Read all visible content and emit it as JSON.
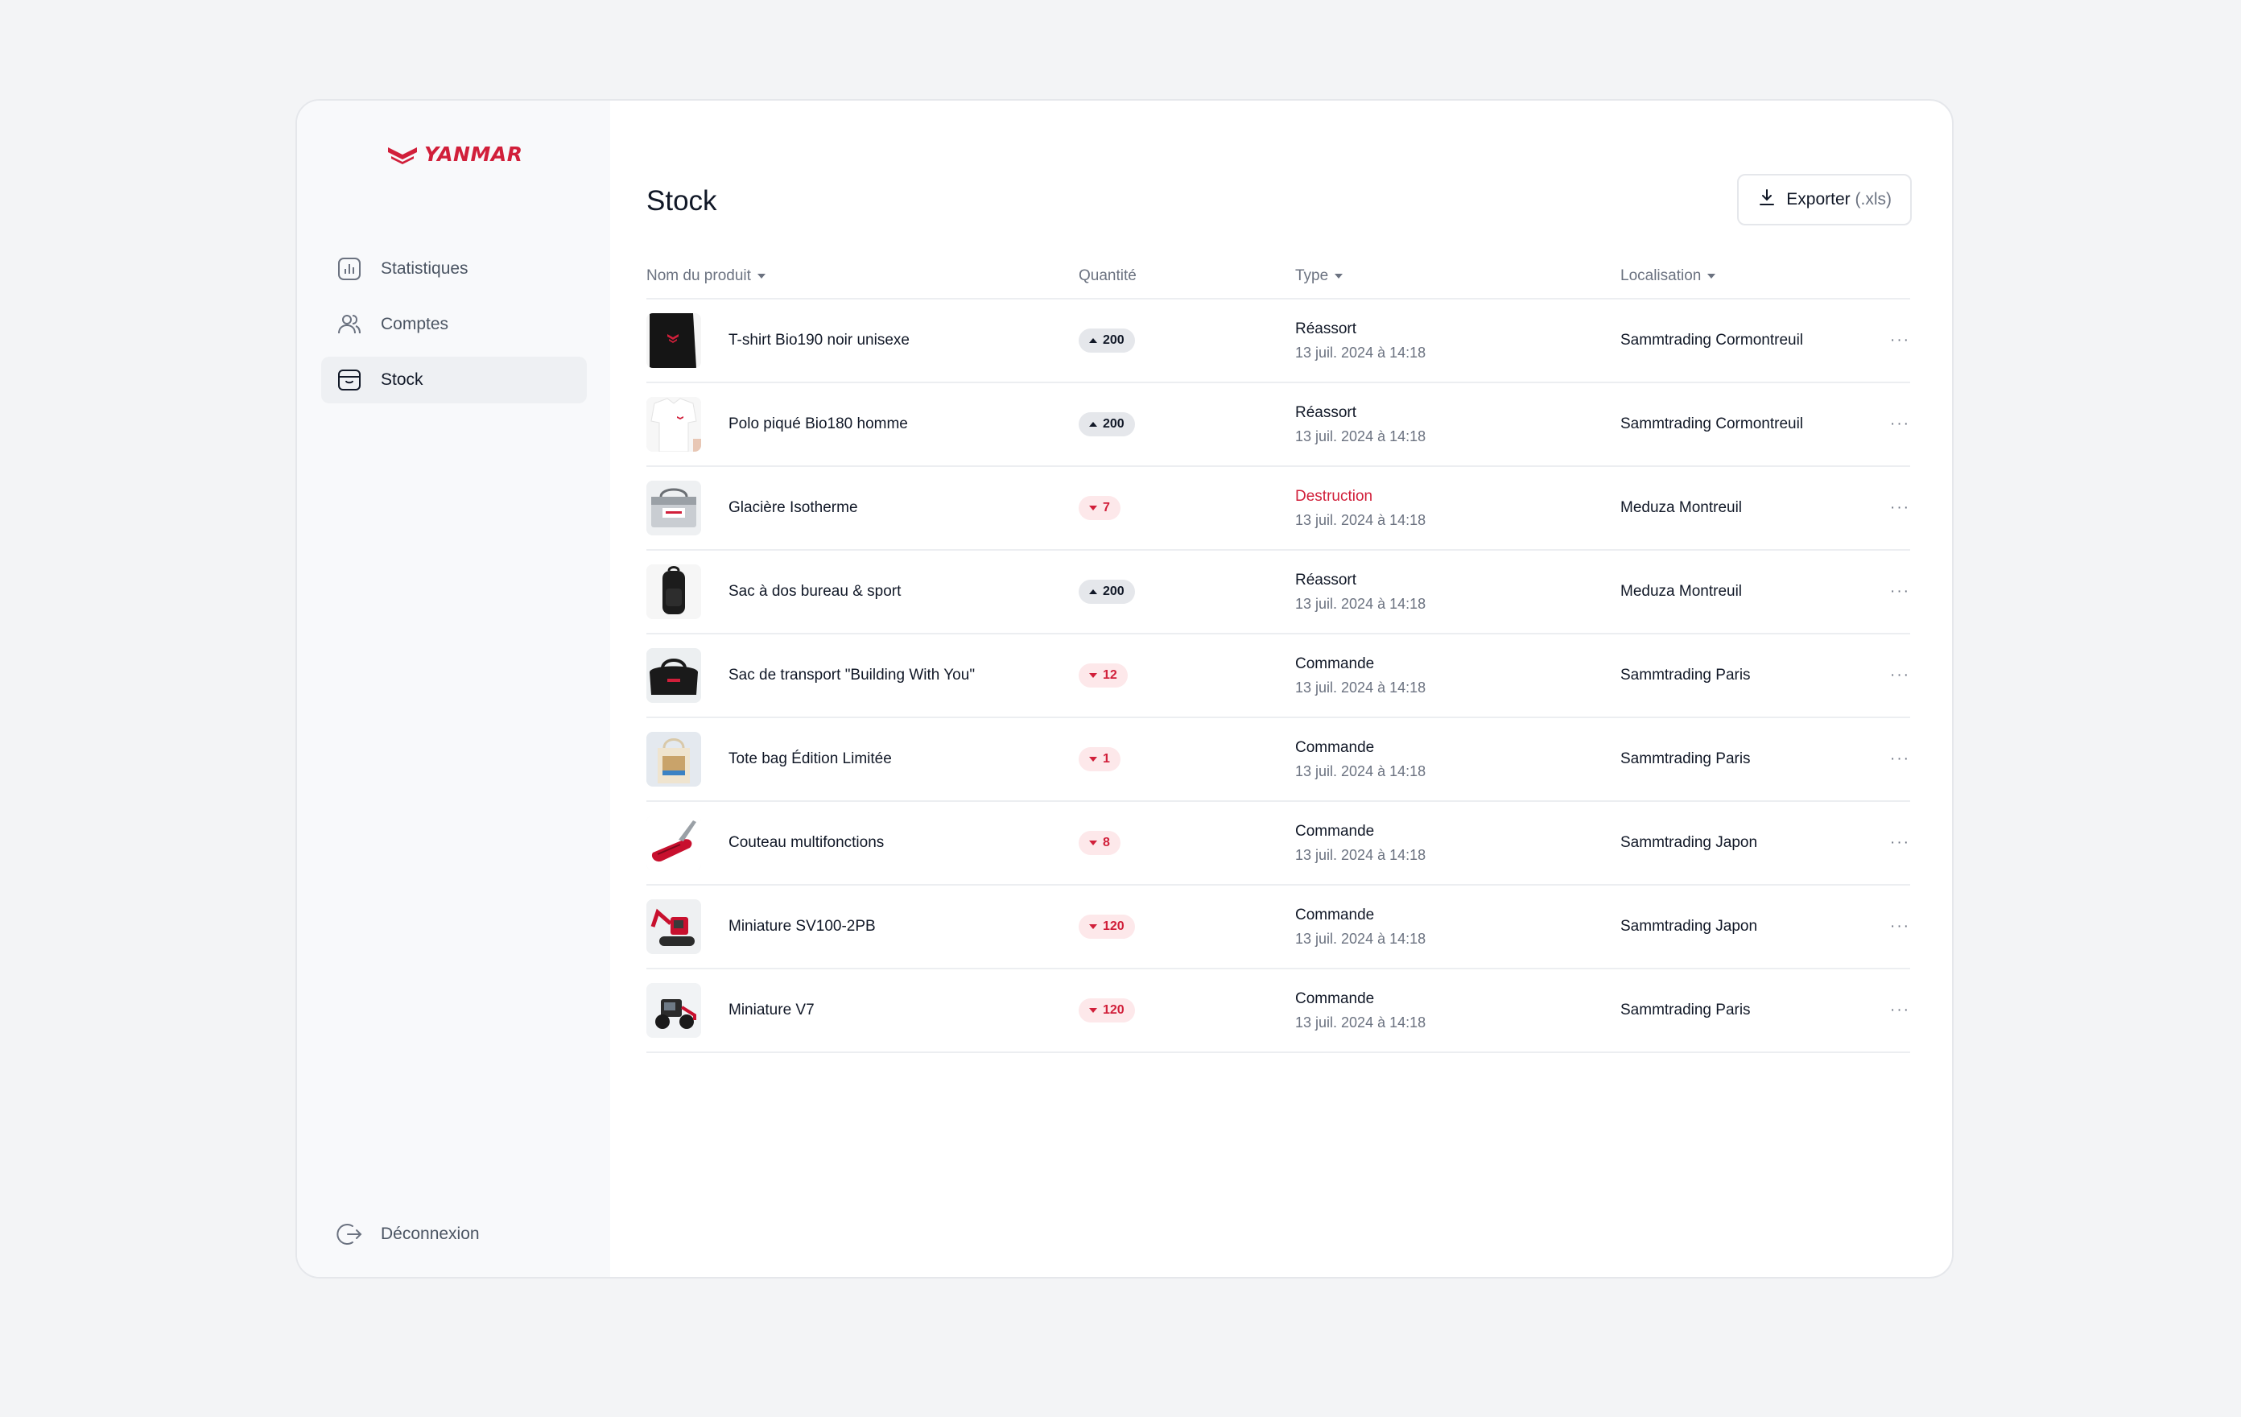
{
  "brand": {
    "name": "YANMAR",
    "color": "#d11f3a"
  },
  "sidebar": {
    "items": [
      {
        "label": "Statistiques",
        "icon": "bar-chart-icon"
      },
      {
        "label": "Comptes",
        "icon": "users-icon"
      },
      {
        "label": "Stock",
        "icon": "box-icon",
        "active": true
      }
    ],
    "logout_label": "Déconnexion"
  },
  "page": {
    "title": "Stock"
  },
  "export": {
    "label": "Exporter",
    "suffix": "(.xls)"
  },
  "table": {
    "headers": {
      "product": "Nom du produit",
      "quantity": "Quantité",
      "type": "Type",
      "location": "Localisation"
    },
    "rows": [
      {
        "name": "T-shirt Bio190 noir unisexe",
        "qty": "200",
        "dir": "up",
        "type": "Réassort",
        "date": "13 juil. 2024 à 14:18",
        "location": "Sammtrading Cormontreuil",
        "thumb": "tshirt-black"
      },
      {
        "name": "Polo piqué Bio180 homme",
        "qty": "200",
        "dir": "up",
        "type": "Réassort",
        "date": "13 juil. 2024 à 14:18",
        "location": "Sammtrading Cormontreuil",
        "thumb": "polo-white"
      },
      {
        "name": "Glacière Isotherme",
        "qty": "7",
        "dir": "down",
        "type": "Destruction",
        "date": "13 juil. 2024 à 14:18",
        "location": "Meduza Montreuil",
        "thumb": "cooler-bag"
      },
      {
        "name": "Sac à dos bureau & sport",
        "qty": "200",
        "dir": "up",
        "type": "Réassort",
        "date": "13 juil. 2024 à 14:18",
        "location": "Meduza Montreuil",
        "thumb": "backpack"
      },
      {
        "name": "Sac de transport \"Building With You\"",
        "qty": "12",
        "dir": "down",
        "type": "Commande",
        "date": "13 juil. 2024 à 14:18",
        "location": "Sammtrading Paris",
        "thumb": "duffel-bag"
      },
      {
        "name": "Tote bag Édition Limitée",
        "qty": "1",
        "dir": "down",
        "type": "Commande",
        "date": "13 juil. 2024 à 14:18",
        "location": "Sammtrading Paris",
        "thumb": "tote-bag"
      },
      {
        "name": "Couteau multifonctions",
        "qty": "8",
        "dir": "down",
        "type": "Commande",
        "date": "13 juil. 2024 à 14:18",
        "location": "Sammtrading Japon",
        "thumb": "knife"
      },
      {
        "name": "Miniature SV100-2PB",
        "qty": "120",
        "dir": "down",
        "type": "Commande",
        "date": "13 juil. 2024 à 14:18",
        "location": "Sammtrading Japon",
        "thumb": "excavator"
      },
      {
        "name": "Miniature V7",
        "qty": "120",
        "dir": "down",
        "type": "Commande",
        "date": "13 juil. 2024 à 14:18",
        "location": "Sammtrading Paris",
        "thumb": "loader"
      }
    ]
  }
}
